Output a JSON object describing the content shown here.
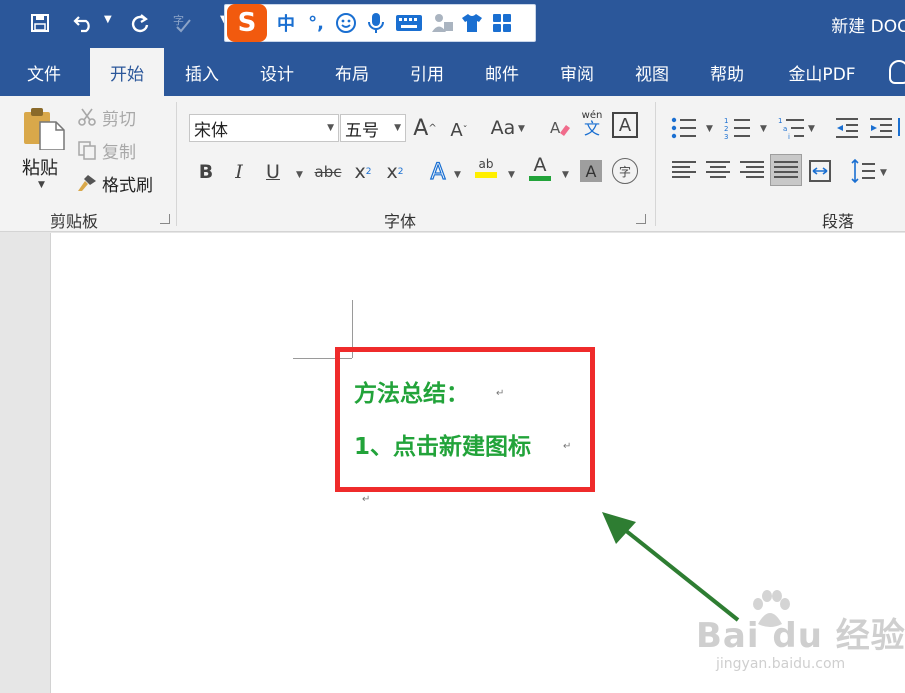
{
  "title_bar": {
    "document_title": "新建 DOC"
  },
  "ime_toolbar": {
    "logo": "S",
    "mode": "中",
    "punct": "°,",
    "icons": [
      "smile-icon",
      "microphone-icon",
      "keyboard-icon",
      "user-card-icon",
      "shirt-icon",
      "grid-icon"
    ]
  },
  "tabs": [
    {
      "label": "文件"
    },
    {
      "label": "开始"
    },
    {
      "label": "插入"
    },
    {
      "label": "设计"
    },
    {
      "label": "布局"
    },
    {
      "label": "引用"
    },
    {
      "label": "邮件"
    },
    {
      "label": "审阅"
    },
    {
      "label": "视图"
    },
    {
      "label": "帮助"
    },
    {
      "label": "金山PDF"
    }
  ],
  "ribbon": {
    "clipboard": {
      "paste": "粘贴",
      "cut": "剪切",
      "copy": "复制",
      "format_painter": "格式刷",
      "group_label": "剪贴板"
    },
    "font": {
      "font_name": "宋体",
      "font_size": "五号",
      "grow": "A",
      "shrink": "A",
      "change_case": "Aa",
      "phonetic_top": "wén",
      "phonetic_bottom": "文",
      "char_border": "A",
      "bold": "B",
      "italic": "I",
      "underline": "U",
      "strike": "abc",
      "subscript": "x",
      "superscript": "x",
      "text_effect": "A",
      "highlight": "ab",
      "font_color": "A",
      "shading": "A",
      "enclose": "字",
      "group_label": "字体"
    },
    "paragraph": {
      "group_label": "段落"
    }
  },
  "document": {
    "line1": "方法总结：",
    "line2": "1、点击新建图标",
    "text_color": "#22a33a",
    "highlight_color": "#ef2b2b",
    "arrow_color": "#2e7d32"
  },
  "watermark": {
    "main": "Bai du 经验",
    "url": "jingyan.baidu.com"
  }
}
